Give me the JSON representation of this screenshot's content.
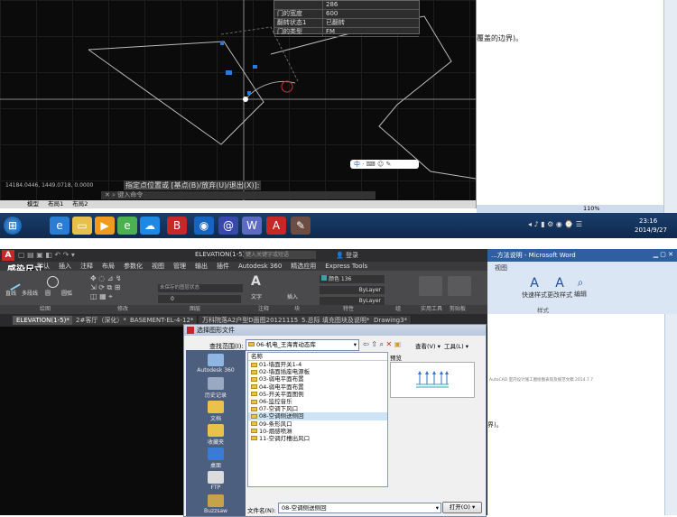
{
  "top_screenshot": {
    "cad": {
      "properties": [
        {
          "key": "",
          "value": "286"
        },
        {
          "key": "门的宽度",
          "value": "600"
        },
        {
          "key": "翻转状态1",
          "value": "已翻转"
        },
        {
          "key": "门的类型",
          "value": "FM"
        }
      ],
      "dynamic_prompt": "指定点位置或 [基点(B)/放弃(U)/退出(X)]:",
      "command_line": "键入命令",
      "coords": "14184.0446, 1449.0718, 0.0000",
      "layout_tabs": [
        "模型",
        "布局1",
        "布局2"
      ],
      "ime_text": "中"
    },
    "word": {
      "text_fragment": "覆盖的边界)。",
      "zoom": "110%"
    },
    "taskbar": {
      "clock": "23:16",
      "date": "2014/9/27"
    }
  },
  "bottom_screenshot": {
    "autocad": {
      "title": "ELEVATION(1-5)",
      "search_placeholder": "键入关键字或短语",
      "login": "登录",
      "overlay_text": "感染尺寸",
      "ribbon_tabs": [
        "默认",
        "插入",
        "注释",
        "布局",
        "参数化",
        "视图",
        "管理",
        "输出",
        "插件",
        "Autodesk 360",
        "精选应用",
        "Express Tools"
      ],
      "panels": [
        "绘图",
        "修改",
        "图层",
        "注释",
        "块",
        "特性",
        "组",
        "实用工具",
        "剪贴板"
      ],
      "draw_tools": [
        "直线",
        "多段线",
        "圆",
        "圆弧"
      ],
      "insert_label": "插入",
      "text_label": "文字",
      "color_value": "颜色 136",
      "bylayer1": "ByLayer",
      "bylayer2": "ByLayer",
      "unsaved_state": "未保存的图层状态",
      "layer_current": "0",
      "doc_tabs": [
        "ELEVATION(1-5)*",
        "2#客厅（深化）*",
        "BASEMENT-EL-4-12*",
        "万科院落A2户型D面图20121115*",
        "5.总际 填充图块及说明*",
        "Drawing3*"
      ]
    },
    "word": {
      "title": "...方法说明 - Microsoft Word",
      "tab": "视图",
      "quick_styles": "快速样式",
      "change_styles": "更改样式",
      "edit": "编辑",
      "style_group": "样式",
      "small_text": "AutoCAD 室内设计施工图绘图表现及规范文稿 2014.7.7",
      "fragment": "界)。"
    },
    "dialog": {
      "title": "选择图形文件",
      "lookin_label": "查找范围(I):",
      "lookin_value": "06-机电_王海青动态库",
      "view_label": "查看(V)",
      "tools_label": "工具(L)",
      "name_header": "名称",
      "preview_label": "预览",
      "filename_label": "文件名(N):",
      "filename_value": "08-空调侧送侧回",
      "open_button": "打开(O)",
      "files": [
        "01-墙面开关1-4",
        "02-墙面插座电源板",
        "03-弱电平面布置",
        "04-弱电平面布置",
        "05-开关平面图例",
        "06-监控音乐",
        "07-空调下风口",
        "08-空调侧送侧回",
        "09-条形风口",
        "10-烟感喷淋",
        "11-空调灯槽出风口"
      ],
      "selected_index": 7,
      "places": [
        "Autodesk 360",
        "历史记录",
        "文档",
        "收藏夹",
        "桌面",
        "FTP",
        "Buzzsaw"
      ]
    }
  }
}
